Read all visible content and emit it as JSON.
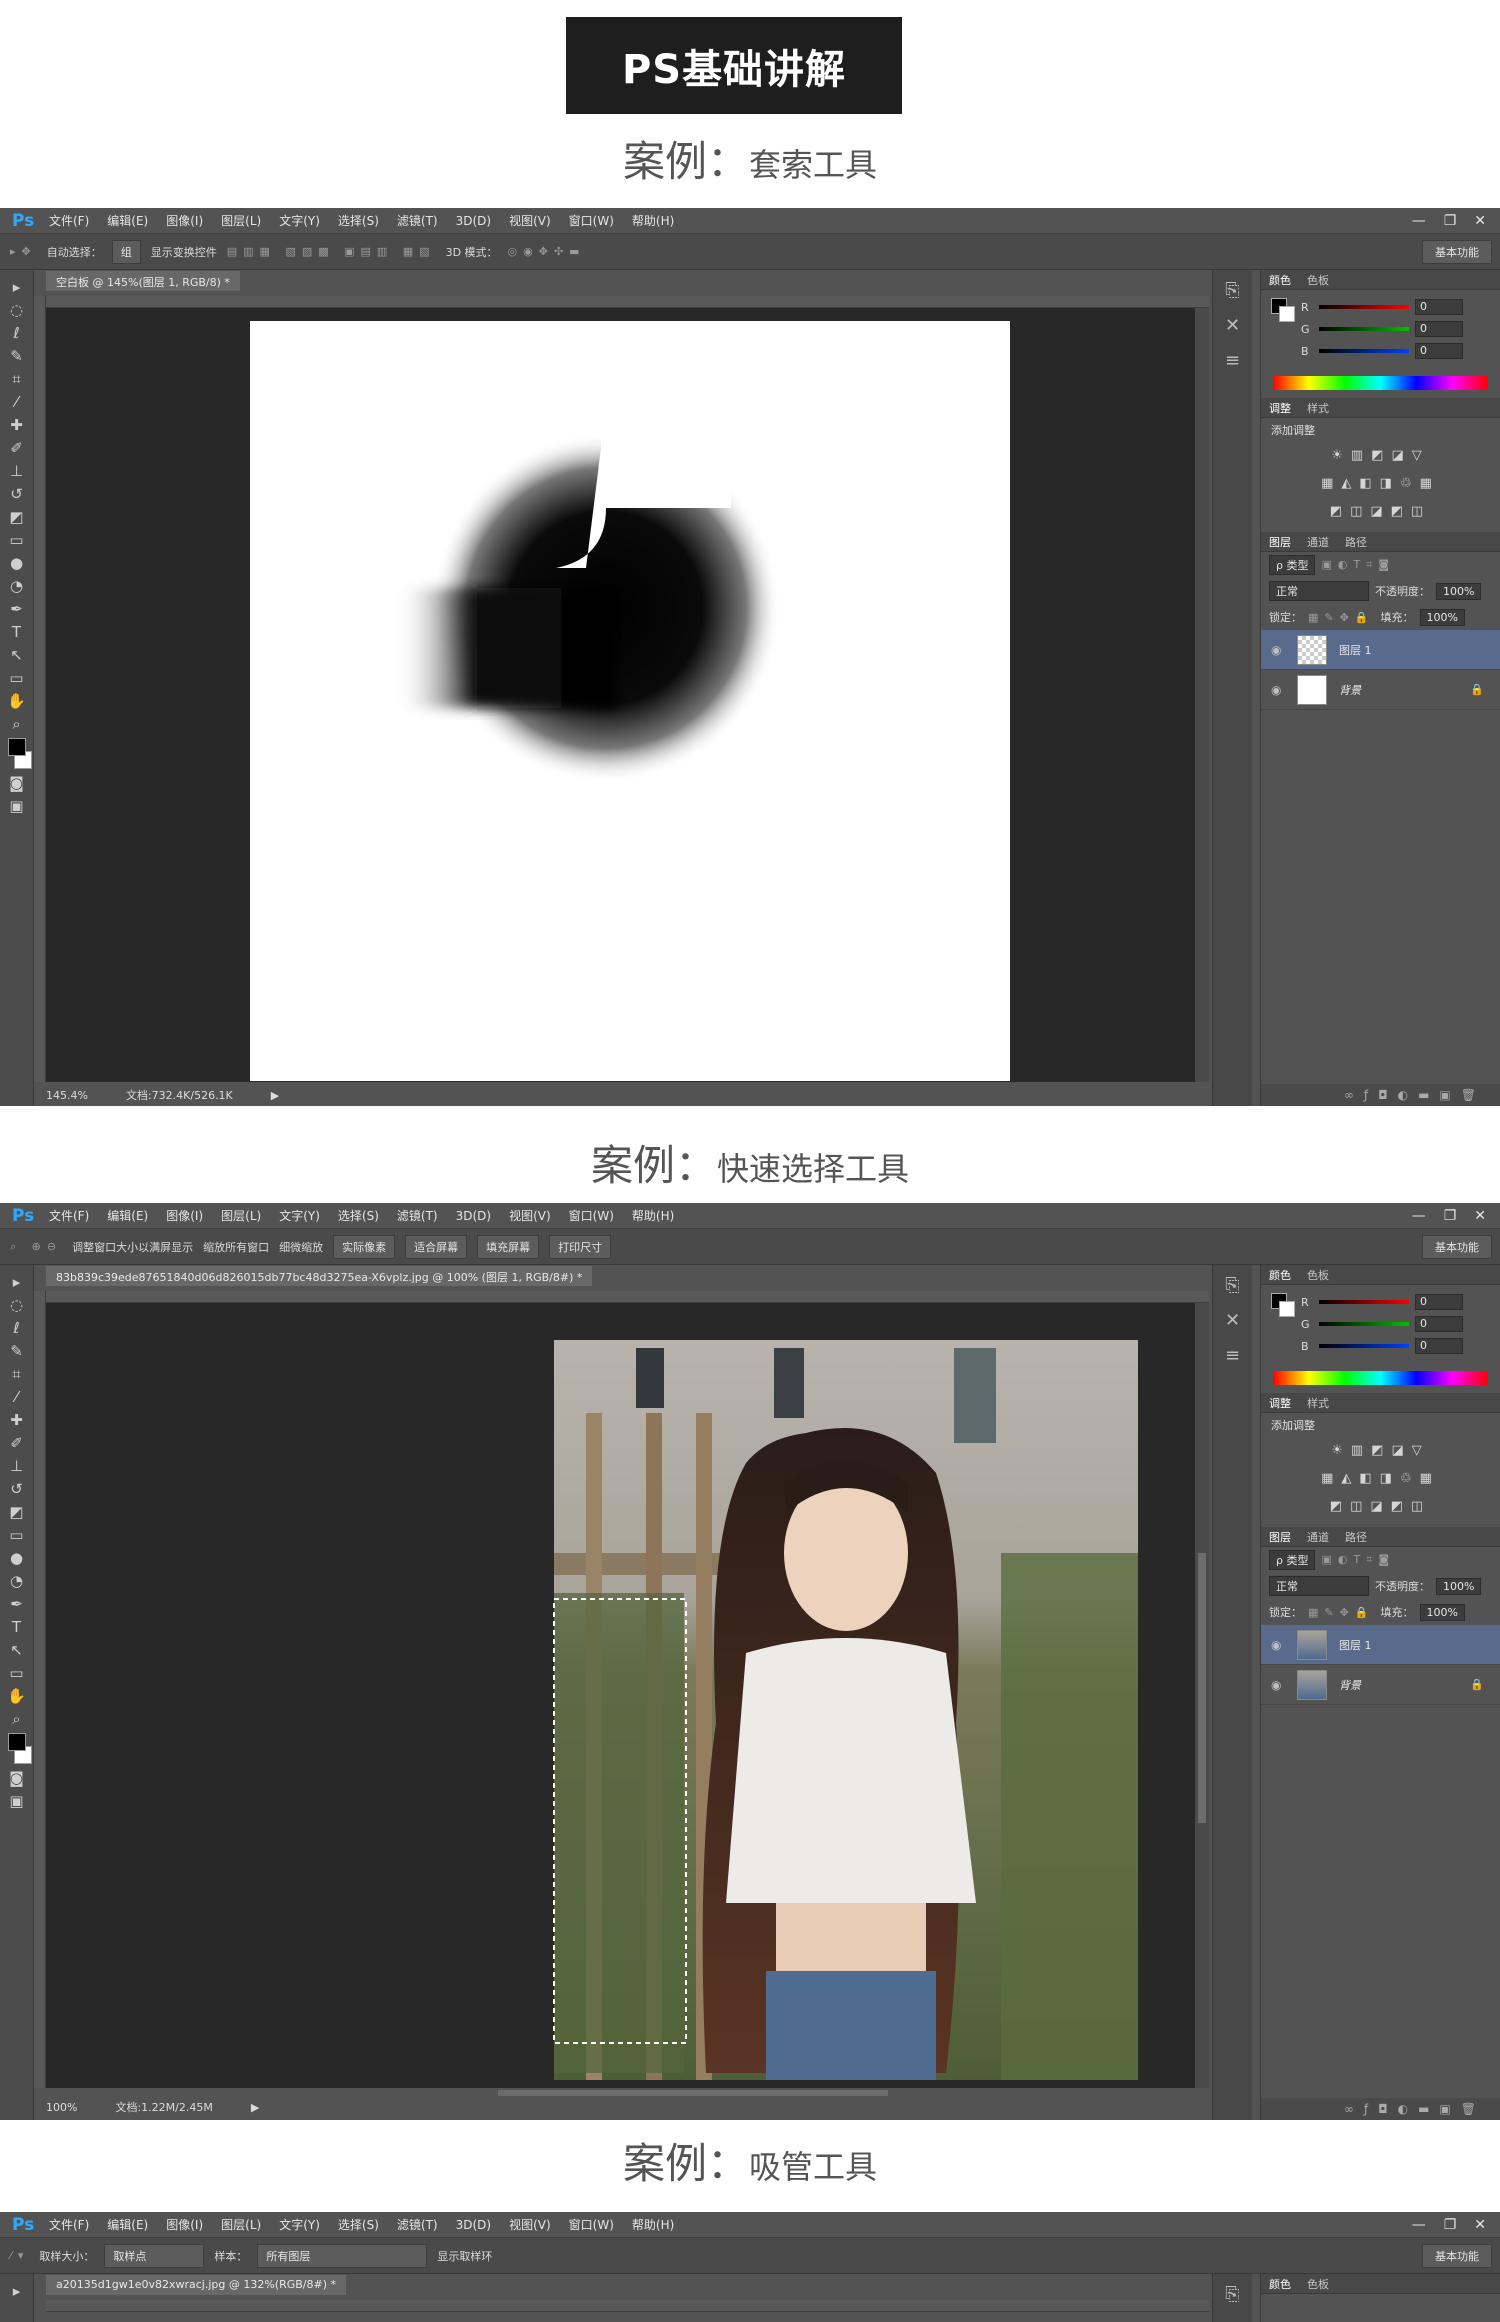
{
  "title": "PS基础讲解",
  "caption_label": "案例：",
  "sections": [
    {
      "example": "套索工具"
    },
    {
      "example": "快速选择工具"
    },
    {
      "example": "吸管工具"
    }
  ],
  "menu": [
    "文件(F)",
    "编辑(E)",
    "图像(I)",
    "图层(L)",
    "文字(Y)",
    "选择(S)",
    "滤镜(T)",
    "3D(D)",
    "视图(V)",
    "窗口(W)",
    "帮助(H)"
  ],
  "ps_logo": "Ps",
  "window_controls": {
    "min": "—",
    "restore": "❐",
    "close": "✕"
  },
  "workspace": "基本功能",
  "win1": {
    "auto_select": "自动选择：",
    "auto_select_value": "组",
    "show_transform": "显示变换控件",
    "mode_3d": "3D 模式：",
    "doc_tab": "空白板 @ 145%(图层 1, RGB/8) *",
    "zoom": "145.4%",
    "doc_info": "文档:732.4K/526.1K",
    "layers": [
      {
        "name": "图层 1",
        "selected": true
      },
      {
        "name": "背景",
        "selected": false
      }
    ]
  },
  "win2": {
    "opts": [
      "调整窗口大小以满屏显示",
      "缩放所有窗口",
      "细微缩放",
      "实际像素",
      "适合屏幕",
      "填充屏幕",
      "打印尺寸"
    ],
    "doc_tab": "83b839c39ede87651840d06d826015db77bc48d3275ea-X6vplz.jpg @ 100% (图层 1, RGB/8#) *",
    "zoom": "100%",
    "doc_info": "文档:1.22M/2.45M",
    "layers": [
      {
        "name": "图层 1",
        "selected": true
      },
      {
        "name": "背景",
        "selected": false
      }
    ]
  },
  "win3": {
    "sample_size": "取样大小：",
    "sample_size_value": "取样点",
    "sample": "样本：",
    "sample_value": "所有图层",
    "show_ring": "显示取样环",
    "doc_tab": "a20135d1gw1e0v82xwracj.jpg @ 132%(RGB/8#) *"
  },
  "panels": {
    "color_tabs": [
      "颜色",
      "色板"
    ],
    "adjust_tabs": [
      "调整",
      "样式"
    ],
    "add_adjust": "添加调整",
    "layer_tabs": [
      "图层",
      "通道",
      "路径"
    ],
    "kind": "ρ 类型",
    "blend": "正常",
    "opacity_label": "不透明度：",
    "opacity": "100%",
    "lock_label": "锁定：",
    "fill_label": "填充：",
    "fill": "100%",
    "rgb": [
      {
        "ch": "R",
        "val": "0"
      },
      {
        "ch": "G",
        "val": "0"
      },
      {
        "ch": "B",
        "val": "0"
      }
    ]
  },
  "colors": {
    "ps_bg": "#535353",
    "canvas_bg": "#282828",
    "accent": "#31a8ff",
    "layer_sel": "#596b8c"
  }
}
